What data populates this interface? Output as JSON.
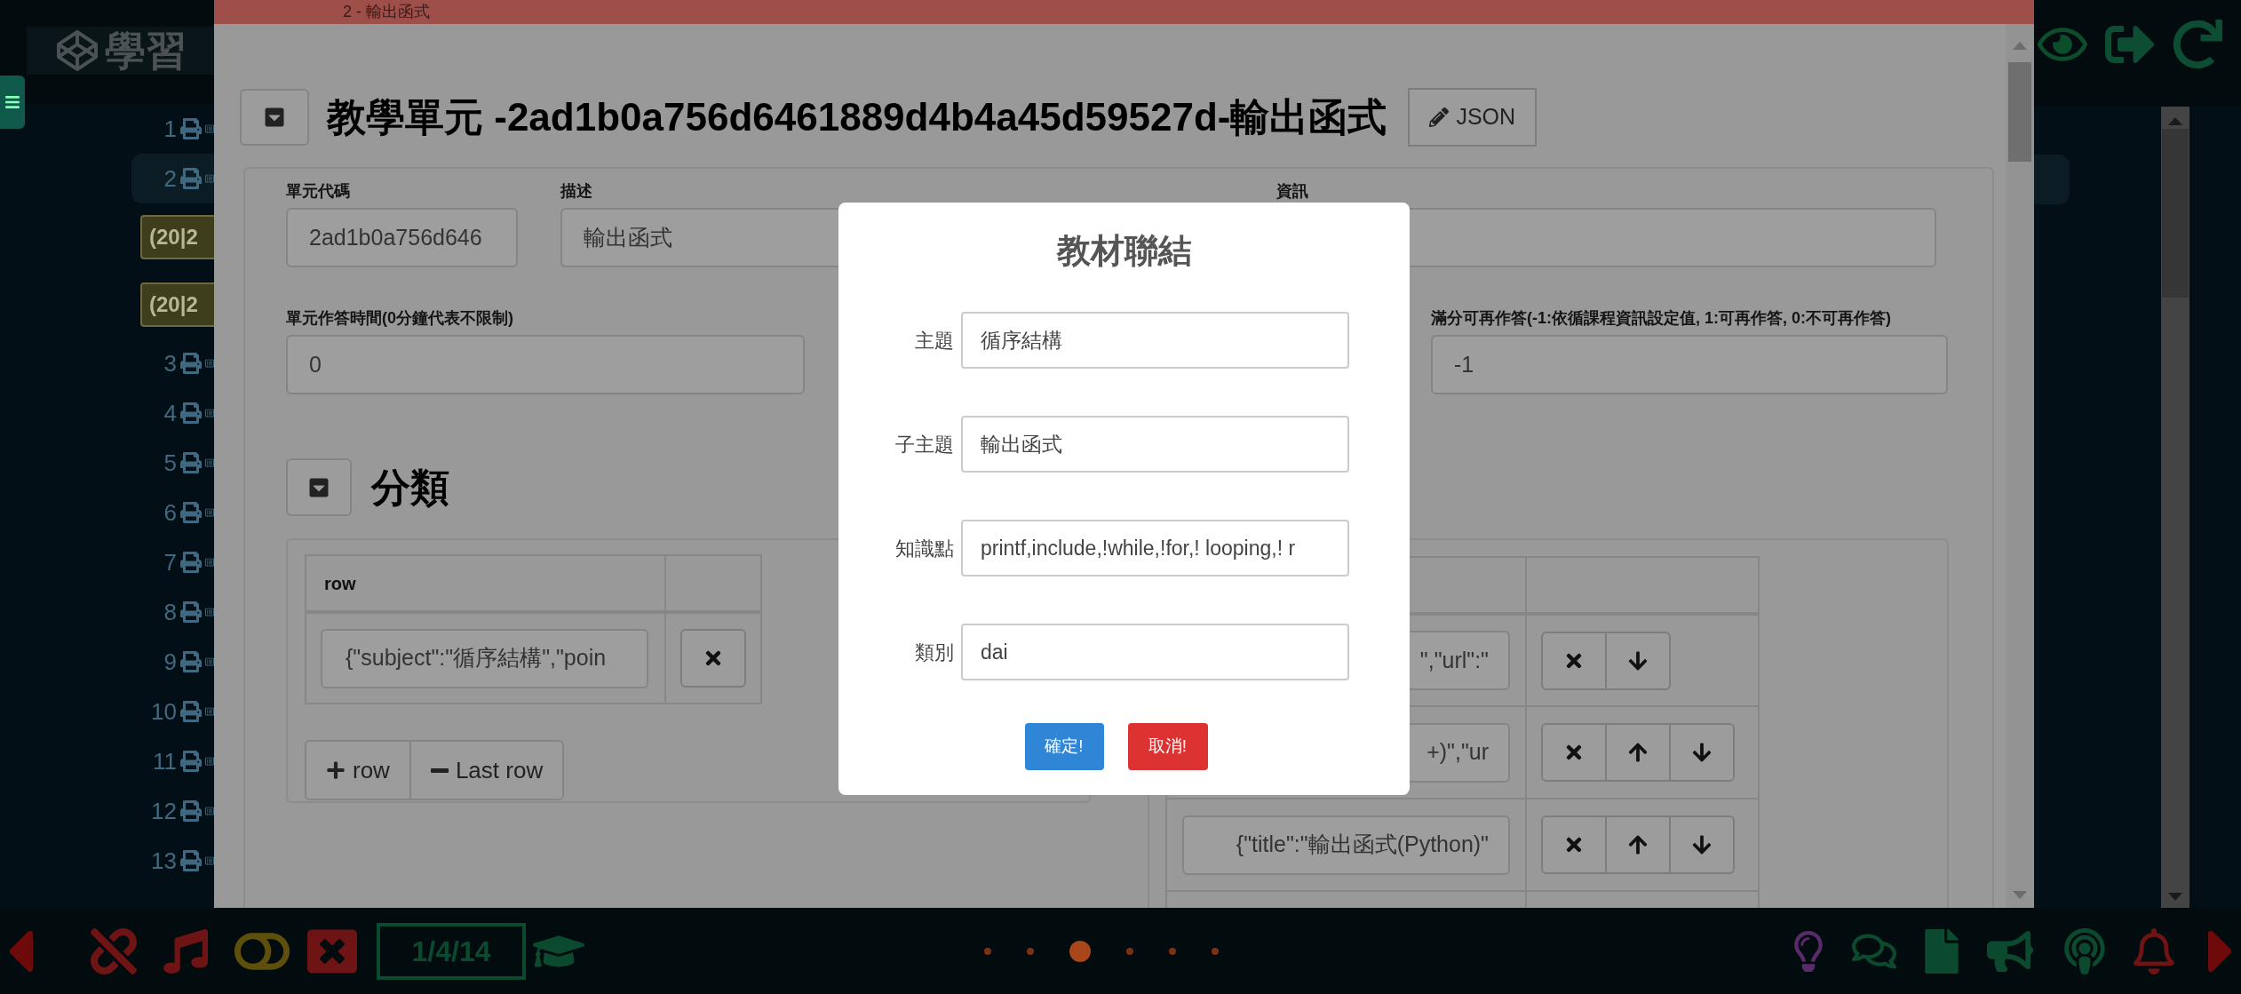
{
  "sidebar": {
    "logo_text": "學習",
    "items": [
      {
        "kind": "unit",
        "label": "1",
        "selected": false
      },
      {
        "kind": "unit",
        "label": "2",
        "selected": true
      },
      {
        "kind": "badge",
        "label": "(20|2"
      },
      {
        "kind": "badge",
        "label": "(20|2"
      },
      {
        "kind": "unit",
        "label": "3",
        "selected": false
      },
      {
        "kind": "unit",
        "label": "4",
        "selected": false
      },
      {
        "kind": "unit",
        "label": "5",
        "selected": false
      },
      {
        "kind": "unit",
        "label": "6",
        "selected": false
      },
      {
        "kind": "unit",
        "label": "7",
        "selected": false
      },
      {
        "kind": "unit",
        "label": "8",
        "selected": false
      },
      {
        "kind": "unit",
        "label": "9",
        "selected": false
      },
      {
        "kind": "unit",
        "label": "10",
        "selected": false
      },
      {
        "kind": "unit",
        "label": "11",
        "selected": false
      },
      {
        "kind": "unit",
        "label": "12",
        "selected": false
      },
      {
        "kind": "unit",
        "label": "13",
        "selected": false
      }
    ]
  },
  "dialog": {
    "title": "2 - 輸出函式",
    "heading": "教學單元 -2ad1b0a756d6461889d4b4a45d59527d-輸出函式",
    "json_button": "JSON",
    "fields_row_1": [
      {
        "label": "單元代碼",
        "value": "2ad1b0a756d646"
      },
      {
        "label": "描述",
        "value": "輸出函式"
      },
      {
        "label": "資訊"
      }
    ],
    "fields_row_2": [
      {
        "label": "單元作答時間(0分鐘代表不限制)",
        "value": "0"
      },
      {
        "label": "滿分可再作答(-1:依循課程資訊設定值, 1:可再作答, 0:不可再作答)",
        "value": "-1"
      }
    ],
    "category": {
      "heading": "分類",
      "left_table": {
        "columns": [
          "row"
        ],
        "rows": [
          {
            "value": "{\"subject\":\"循序結構\",\"poin"
          }
        ],
        "buttons": [
          {
            "kind": "add",
            "label": "row"
          },
          {
            "kind": "remove",
            "label": "Last row"
          }
        ]
      },
      "right_table": {
        "rows": [
          {
            "value": "\",\"url\":\"",
            "up": false
          },
          {
            "value": "+)\",\"ur",
            "up": true
          },
          {
            "value": "{\"title\":\"輸出函式(Python)\"",
            "up": true
          }
        ]
      }
    }
  },
  "modal": {
    "title": "教材聯結",
    "fields": [
      {
        "label": "主題",
        "value": "循序結構"
      },
      {
        "label": "子主題",
        "value": "輸出函式"
      },
      {
        "label": "知識點",
        "value": "printf,include,!while,!for,! looping,! r"
      },
      {
        "label": "類別",
        "value": "dai"
      }
    ],
    "confirm": "確定!",
    "cancel": "取消!"
  },
  "bottom_bar": {
    "counter": "1/4/14",
    "dots": [
      {
        "selected": false
      },
      {
        "selected": false
      },
      {
        "selected": true
      },
      {
        "selected": false
      },
      {
        "selected": false
      },
      {
        "selected": false
      }
    ]
  }
}
